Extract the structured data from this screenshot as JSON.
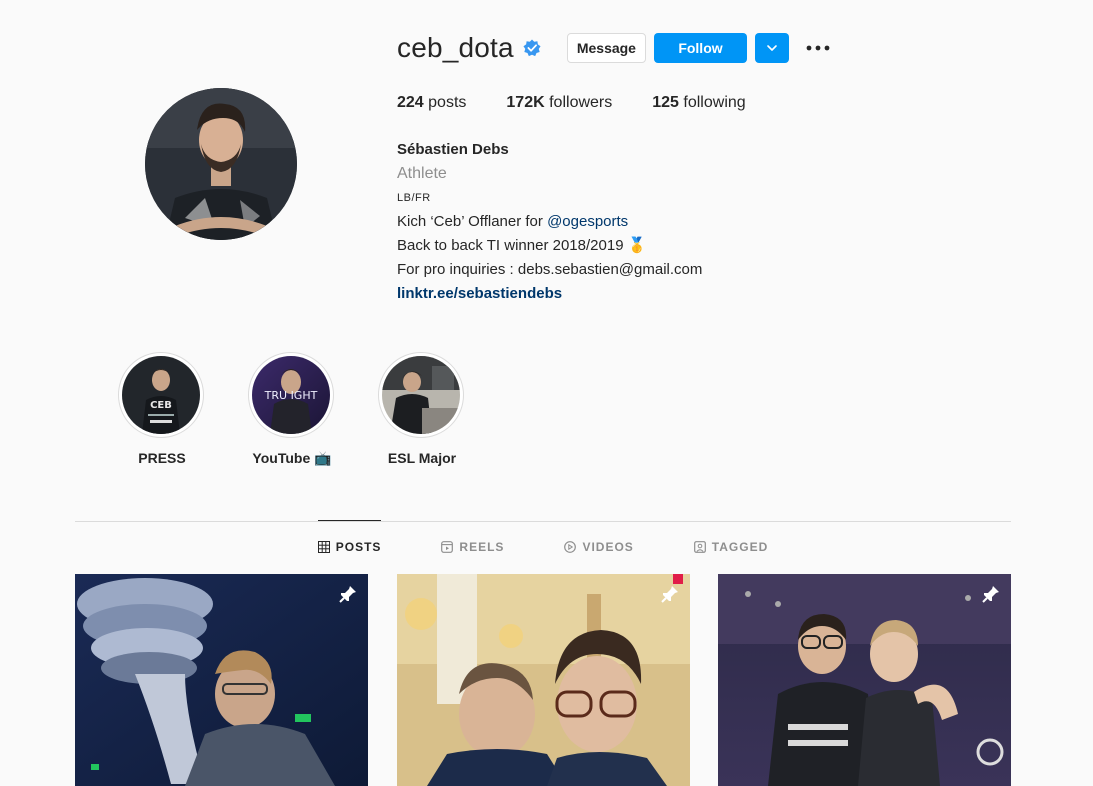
{
  "profile": {
    "username": "ceb_dota",
    "verified_icon": "verified-badge-icon",
    "buttons": {
      "message": "Message",
      "follow": "Follow"
    },
    "stats": {
      "posts_count": "224",
      "posts_label": "posts",
      "followers_count": "172K",
      "followers_label": "followers",
      "following_count": "125",
      "following_label": "following"
    },
    "bio": {
      "name": "Sébastien Debs",
      "category": "Athlete",
      "line_small": "LB/FR",
      "line1_prefix": "Kich ‘Ceb’ Offlaner for ",
      "line1_mention": "@ogesports",
      "line2": "Back to back TI winner 2018/2019 🥇",
      "line3": "For pro inquiries : debs.sebastien@gmail.com",
      "link": "linktr.ee/sebastiendebs"
    }
  },
  "highlights": [
    {
      "label": "PRESS"
    },
    {
      "label": "YouTube 📺"
    },
    {
      "label": "ESL Major"
    }
  ],
  "tabs": [
    {
      "label": "POSTS",
      "icon": "grid-icon",
      "active": true
    },
    {
      "label": "REELS",
      "icon": "reels-icon",
      "active": false
    },
    {
      "label": "VIDEOS",
      "icon": "play-circle-icon",
      "active": false
    },
    {
      "label": "TAGGED",
      "icon": "tag-user-icon",
      "active": false
    }
  ],
  "posts": [
    {
      "pinned": true
    },
    {
      "pinned": true
    },
    {
      "pinned": true
    }
  ],
  "colors": {
    "primary_blue": "#0095f6",
    "link_blue": "#00376b",
    "text": "#262626",
    "muted": "#8e8e8e",
    "border": "#dbdbdb",
    "background": "#fafafa"
  }
}
